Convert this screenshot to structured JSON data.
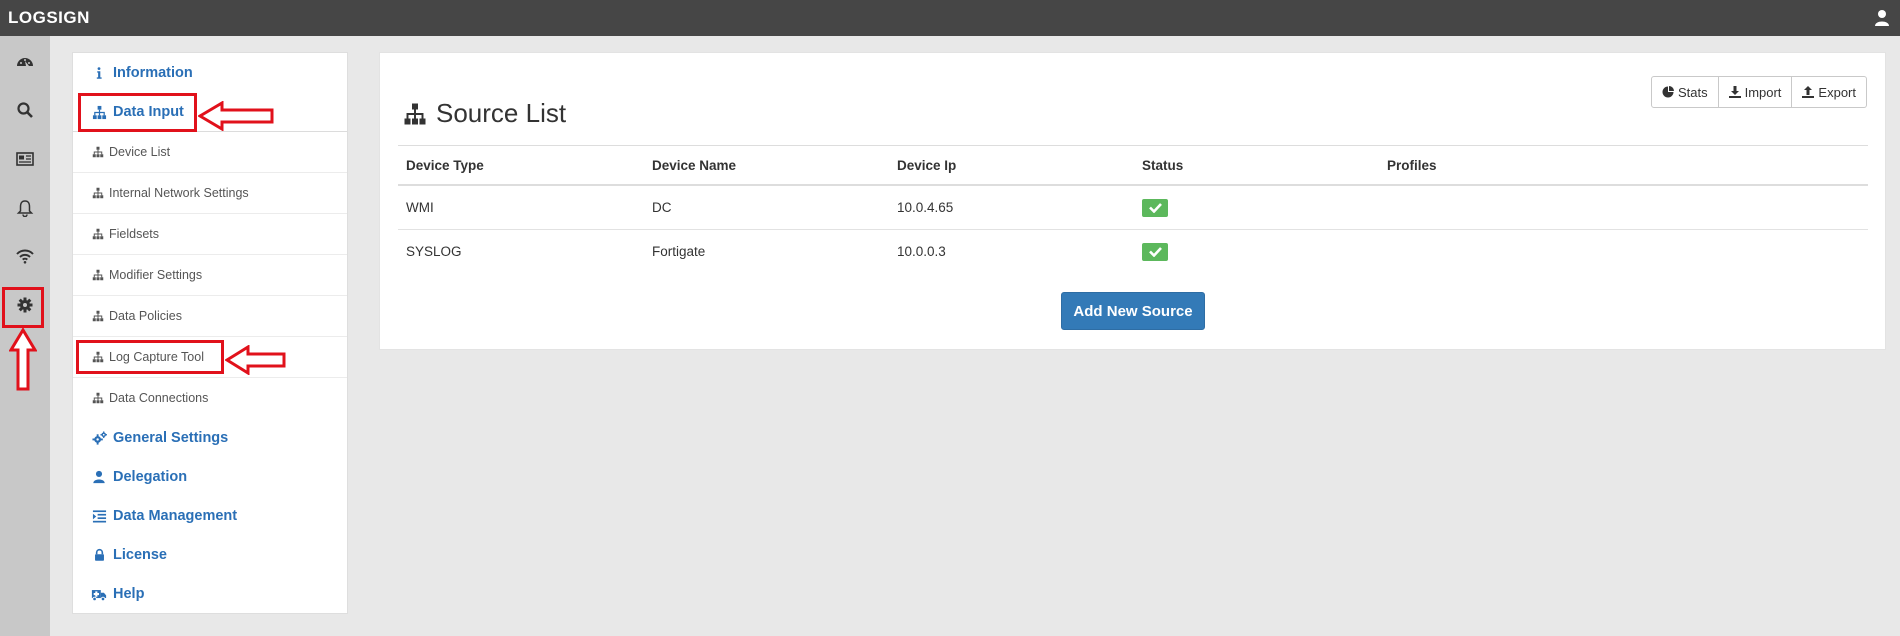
{
  "app": {
    "logo": "LOGSIGN"
  },
  "rail": {
    "icons": [
      "dashboard-icon",
      "search-icon",
      "newspaper-icon",
      "bell-icon",
      "wifi-icon",
      "gear-icon"
    ]
  },
  "menu": {
    "items": [
      {
        "label": "Information",
        "icon": "info-icon",
        "type": "main"
      },
      {
        "label": "Data Input",
        "icon": "sitemap-icon",
        "type": "main"
      },
      {
        "label": "Device List",
        "icon": "sitemap-icon",
        "type": "sub"
      },
      {
        "label": "Internal Network Settings",
        "icon": "sitemap-icon",
        "type": "sub"
      },
      {
        "label": "Fieldsets",
        "icon": "sitemap-icon",
        "type": "sub"
      },
      {
        "label": "Modifier Settings",
        "icon": "sitemap-icon",
        "type": "sub"
      },
      {
        "label": "Data Policies",
        "icon": "sitemap-icon",
        "type": "sub"
      },
      {
        "label": "Log Capture Tool",
        "icon": "sitemap-icon",
        "type": "sub"
      },
      {
        "label": "Data Connections",
        "icon": "sitemap-icon",
        "type": "sub"
      },
      {
        "label": "General Settings",
        "icon": "cogs-icon",
        "type": "main"
      },
      {
        "label": "Delegation",
        "icon": "user-icon",
        "type": "main"
      },
      {
        "label": "Data Management",
        "icon": "indent-icon",
        "type": "main"
      },
      {
        "label": "License",
        "icon": "lock-icon",
        "type": "main"
      },
      {
        "label": "Help",
        "icon": "ambulance-icon",
        "type": "main"
      }
    ]
  },
  "main": {
    "title": "Source List",
    "buttons": {
      "stats": "Stats",
      "import": "Import",
      "export": "Export"
    },
    "table": {
      "headers": [
        "Device Type",
        "Device Name",
        "Device Ip",
        "Status",
        "Profiles"
      ],
      "rows": [
        {
          "type": "WMI",
          "name": "DC",
          "ip": "10.0.4.65",
          "status": "ok",
          "profiles": ""
        },
        {
          "type": "SYSLOG",
          "name": "Fortigate",
          "ip": "10.0.0.3",
          "status": "ok",
          "profiles": ""
        }
      ]
    },
    "add_button": "Add New Source"
  },
  "colors": {
    "topbar": "#464646",
    "accent": "#2a6fb6",
    "primary_button": "#337ab7",
    "status_ok": "#5cb85c",
    "annotation": "#e1111b"
  }
}
